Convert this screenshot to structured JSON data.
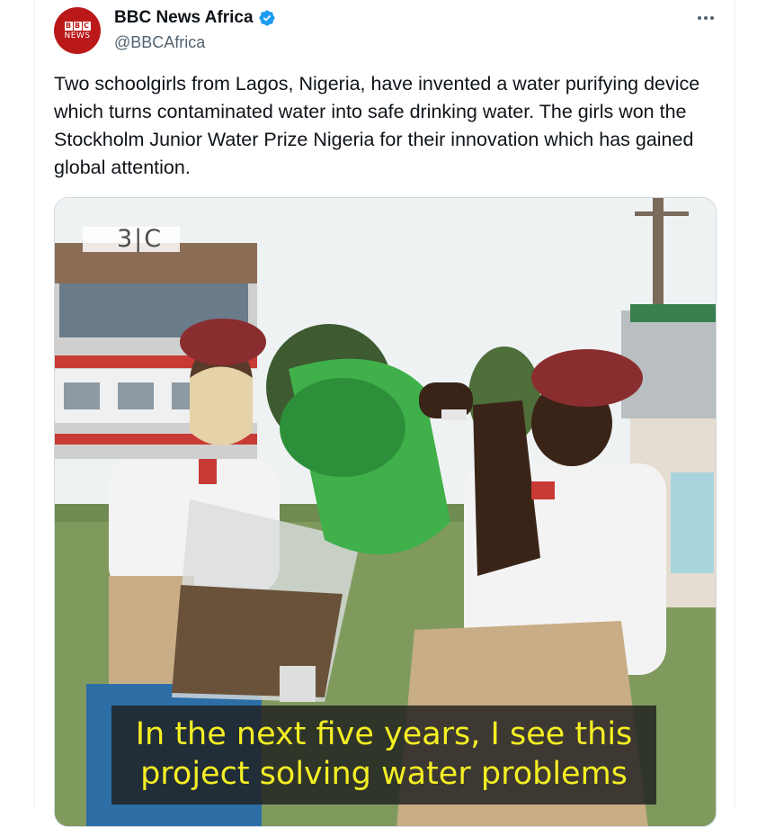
{
  "author": {
    "display_name": "BBC News Africa",
    "handle": "@BBCAfrica",
    "avatar_letters": [
      "B",
      "B",
      "C"
    ],
    "avatar_word": "NEWS",
    "avatar_color": "#bb1919",
    "verified_color": "#1d9bf0"
  },
  "tweet": {
    "text": "Two schoolgirls from Lagos, Nigeria, have invented a water purifying device which turns contaminated water into safe drinking water. The girls won the Stockholm Junior Water Prize Nigeria for their innovation which has gained global attention."
  },
  "media": {
    "watermark": "3|C",
    "caption_line1": "In the next five years, I see this",
    "caption_line2": "project solving water problems",
    "caption_color": "#f4ee24"
  },
  "icons": {
    "more": "more-horizontal-icon",
    "verified": "verified-badge-icon"
  }
}
